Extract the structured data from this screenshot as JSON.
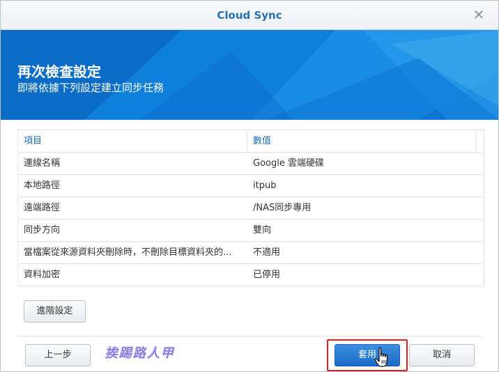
{
  "window": {
    "title": "Cloud Sync",
    "close_glyph": "✕"
  },
  "banner": {
    "title": "再次檢查設定",
    "subtitle": "即將依據下列設定建立同步任務"
  },
  "table": {
    "columns": [
      "項目",
      "數值"
    ],
    "rows": [
      {
        "item": "連線名稱",
        "value": "Google 雲端硬碟"
      },
      {
        "item": "本地路徑",
        "value": "itpub"
      },
      {
        "item": "遠端路徑",
        "value": "/NAS同步專用"
      },
      {
        "item": "同步方向",
        "value": "雙向"
      },
      {
        "item": "當檔案從來源資料夾刪除時，不刪除目標資料夾的...",
        "value": "不適用"
      },
      {
        "item": "資料加密",
        "value": "已停用"
      }
    ]
  },
  "buttons": {
    "advanced": "進階設定",
    "back": "上一步",
    "apply": "套用",
    "cancel": "取消"
  },
  "watermark": "挨踢路人甲",
  "colors": {
    "accent": "#2a6fb2",
    "banner": "#0a74d4",
    "apply_button": "#1b6cc8",
    "highlight": "#e02020"
  },
  "icons": {
    "close": "close-icon",
    "cursor": "hand-pointer-icon"
  }
}
